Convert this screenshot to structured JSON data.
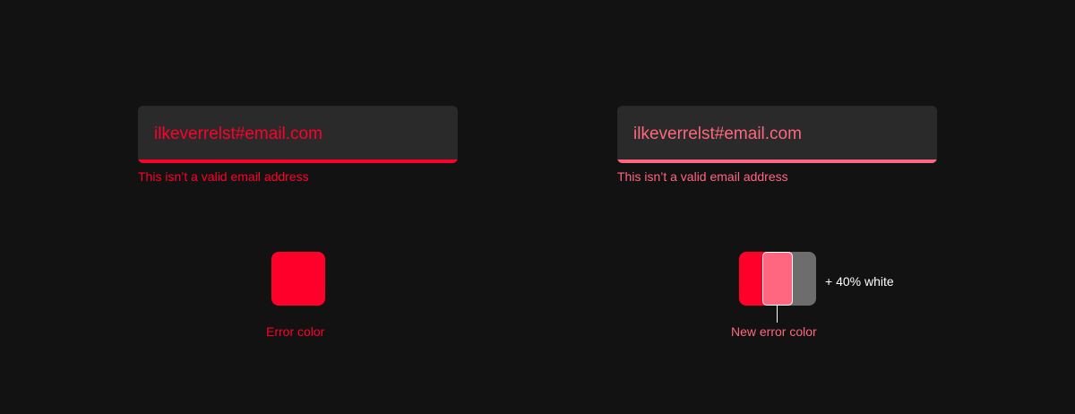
{
  "colors": {
    "background": "#121212",
    "field_bg": "#2a2a2a",
    "error": "#ff002b",
    "error_new": "#ff6680",
    "white": "#ffffff",
    "white_40": "#6d6d6d"
  },
  "left": {
    "field_value": "ilkeverrelst#email.com",
    "helper_text": "This isn’t a valid email address",
    "swatch_caption": "Error color"
  },
  "right": {
    "field_value": "ilkeverrelst#email.com",
    "helper_text": "This isn’t a valid email address",
    "mix_label": "+ 40% white",
    "swatch_caption": "New error color"
  }
}
